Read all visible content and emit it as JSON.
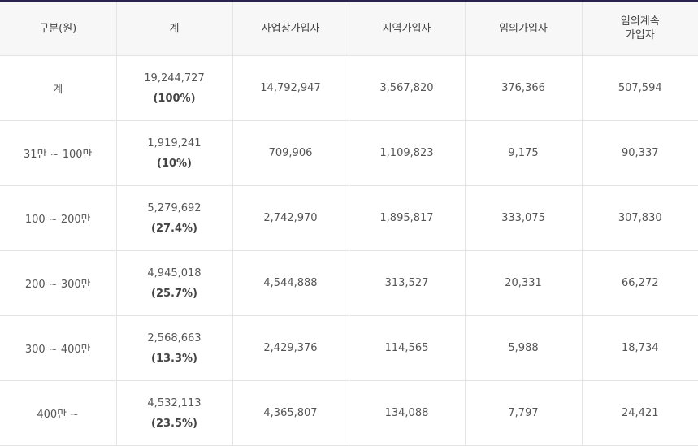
{
  "table": {
    "headers": [
      "구분(원)",
      "계",
      "사업장가입자",
      "지역가입자",
      "임의가입자",
      "임의계속\n가입자"
    ],
    "header_lines": [
      [
        "구분(원)"
      ],
      [
        "계"
      ],
      [
        "사업장가입자"
      ],
      [
        "지역가입자"
      ],
      [
        "임의가입자"
      ],
      [
        "임의계속",
        "가입자"
      ]
    ],
    "rows": [
      {
        "category": "계",
        "total": "19,244,727",
        "total_pct": "(100%)",
        "workplace": "14,792,947",
        "regional": "3,567,820",
        "voluntary": "376,366",
        "voluntary_continued": "507,594"
      },
      {
        "category": "31만 ~ 100만",
        "total": "1,919,241",
        "total_pct": "(10%)",
        "workplace": "709,906",
        "regional": "1,109,823",
        "voluntary": "9,175",
        "voluntary_continued": "90,337"
      },
      {
        "category": "100 ~ 200만",
        "total": "5,279,692",
        "total_pct": "(27.4%)",
        "workplace": "2,742,970",
        "regional": "1,895,817",
        "voluntary": "333,075",
        "voluntary_continued": "307,830"
      },
      {
        "category": "200 ~ 300만",
        "total": "4,945,018",
        "total_pct": "(25.7%)",
        "workplace": "4,544,888",
        "regional": "313,527",
        "voluntary": "20,331",
        "voluntary_continued": "66,272"
      },
      {
        "category": "300 ~ 400만",
        "total": "2,568,663",
        "total_pct": "(13.3%)",
        "workplace": "2,429,376",
        "regional": "114,565",
        "voluntary": "5,988",
        "voluntary_continued": "18,734"
      },
      {
        "category": "400만 ~",
        "total": "4,532,113",
        "total_pct": "(23.5%)",
        "workplace": "4,365,807",
        "regional": "134,088",
        "voluntary": "7,797",
        "voluntary_continued": "24,421"
      }
    ]
  },
  "colors": {
    "top_border": "#2a2350",
    "header_bg": "#f7f7f7",
    "grid": "#e4e4e4"
  }
}
